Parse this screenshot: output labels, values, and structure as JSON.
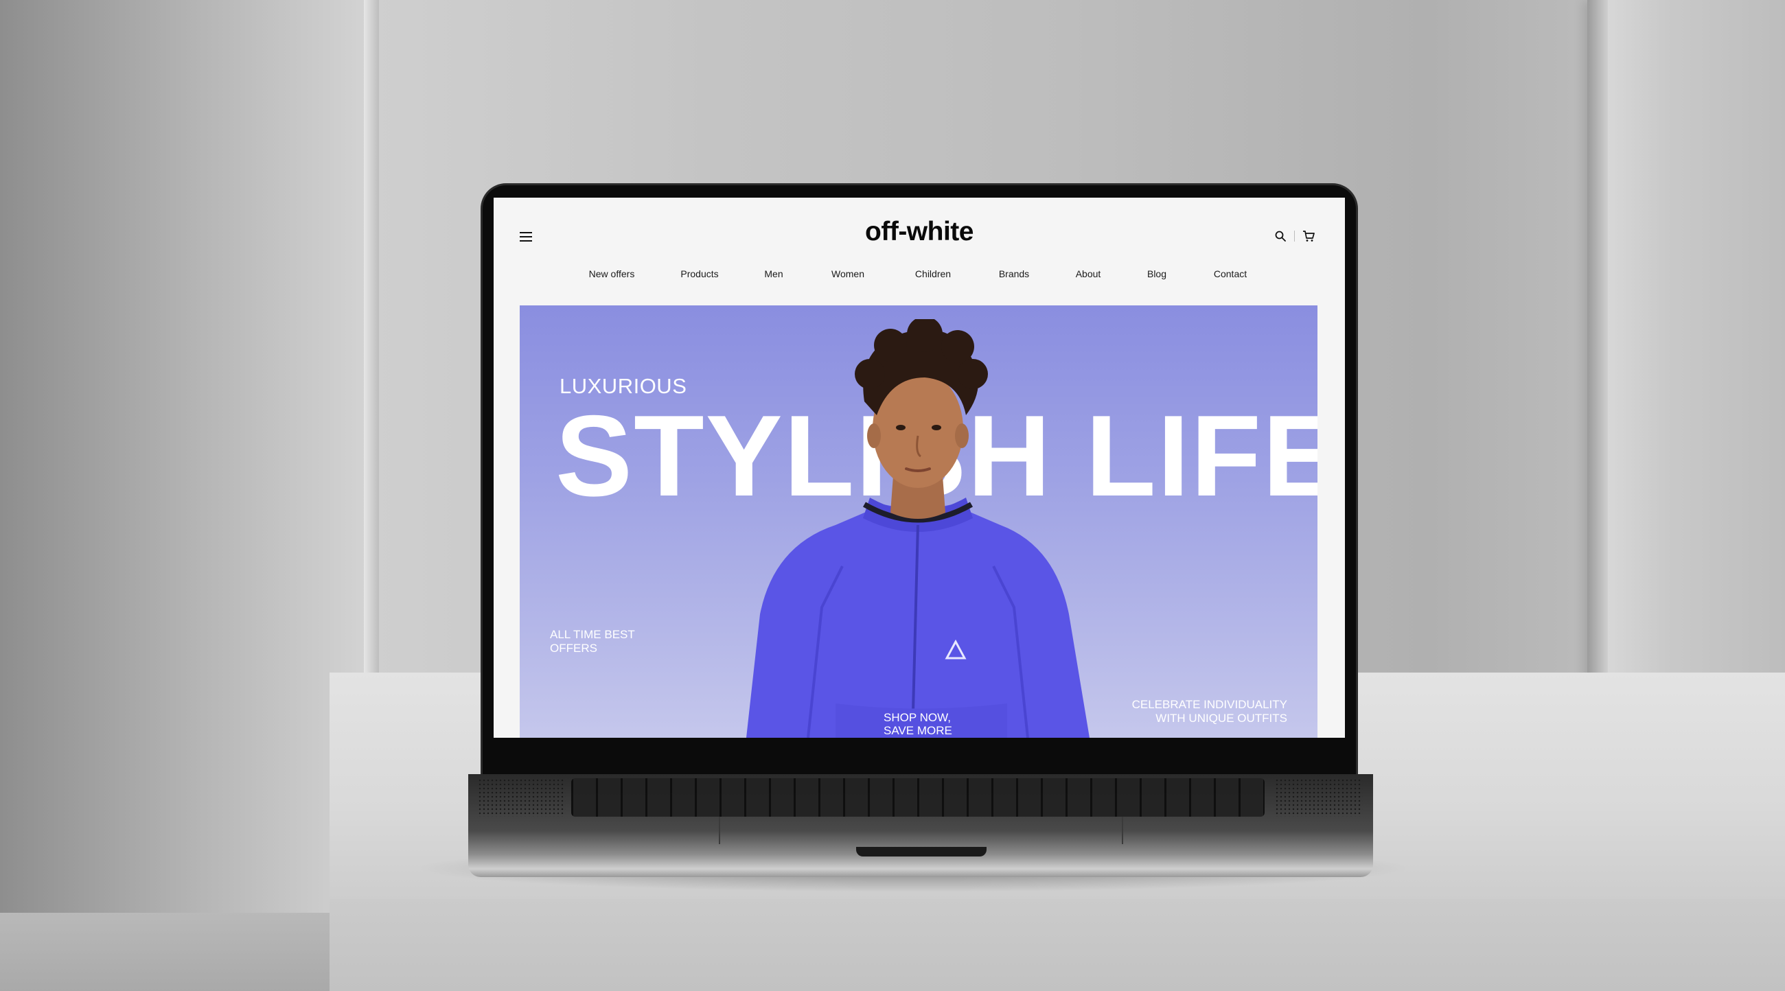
{
  "site": {
    "logo": "off-white"
  },
  "nav": {
    "items": [
      {
        "label": "New offers"
      },
      {
        "label": "Products"
      },
      {
        "label": "Men"
      },
      {
        "label": "Women"
      },
      {
        "label": "Children"
      },
      {
        "label": "Brands"
      },
      {
        "label": "About"
      },
      {
        "label": "Blog"
      },
      {
        "label": "Contact"
      }
    ]
  },
  "header": {
    "icons": [
      "menu-icon",
      "search-icon",
      "cart-icon"
    ]
  },
  "hero": {
    "kicker": "LUXURIOUS",
    "title": "STYLISH LIFE",
    "left_line1": "ALL TIME BEST",
    "left_line2": "OFFERS",
    "center_line1": "SHOP NOW,",
    "center_line2": "SAVE MORE",
    "right_line1": "CELEBRATE INDIVIDUALITY",
    "right_line2": "WITH UNIQUE OUTFITS",
    "background_color": "#9ea2e4",
    "jacket_color": "#5a55e6"
  }
}
